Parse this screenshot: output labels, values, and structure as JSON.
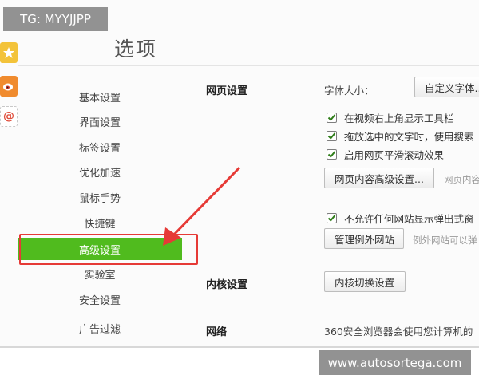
{
  "window": {
    "title": "选项"
  },
  "sidebar": {
    "items": [
      {
        "label": "基本设置"
      },
      {
        "label": "界面设置"
      },
      {
        "label": "标签设置"
      },
      {
        "label": "优化加速"
      },
      {
        "label": "鼠标手势"
      },
      {
        "label": "快捷键"
      },
      {
        "label": "高级设置",
        "active": true
      },
      {
        "label": "实验室"
      },
      {
        "label": "安全设置"
      },
      {
        "label": "广告过滤"
      }
    ]
  },
  "content": {
    "webpage_section": {
      "title": "网页设置",
      "font_size_label": "字体大小：",
      "font_size_button": "自定义字体...",
      "checkboxes": [
        {
          "label": "在视频右上角显示工具栏",
          "checked": true
        },
        {
          "label": "拖放选中的文字时，使用搜索",
          "checked": true
        },
        {
          "label": "启用网页平滑滚动效果",
          "checked": true
        }
      ],
      "advanced_button": "网页内容高级设置...",
      "advanced_hint": "网页内容",
      "popup_checkbox": {
        "label": "不允许任何网站显示弹出式窗",
        "checked": true
      },
      "exceptions_button": "管理例外网站",
      "exceptions_hint": "例外网站可以弹"
    },
    "kernel_section": {
      "title": "内核设置",
      "button": "内核切换设置"
    },
    "network_section": {
      "title": "网络",
      "description": "360安全浏览器会使用您计算机的"
    }
  },
  "watermarks": {
    "top": "TG: MYYJJPP",
    "bottom": "www.autosortega.com"
  },
  "colors": {
    "active_nav": "#50bb1e",
    "highlight_frame": "#e63a36",
    "arrow": "#e63a36",
    "checkbox_check": "#2f7d19"
  },
  "icons": {
    "strip": [
      "star-icon",
      "weibo-icon",
      "email-icon"
    ],
    "checkbox": "checkmark-icon"
  }
}
